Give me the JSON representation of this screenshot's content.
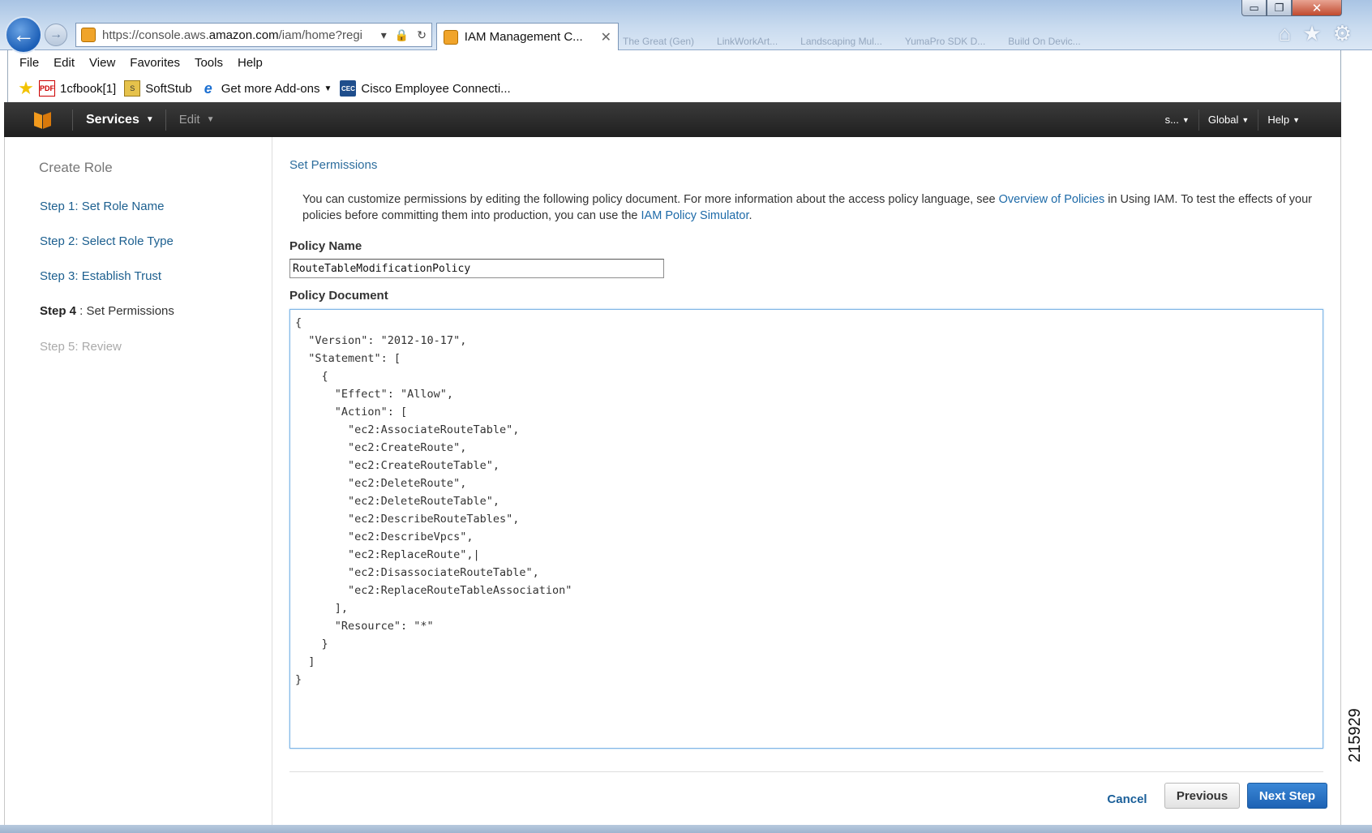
{
  "browser": {
    "window_buttons": [
      "▭",
      "❐",
      "✕"
    ],
    "back_icon": "←",
    "forward_icon": "→",
    "address": {
      "prefix": "https://console.aws.",
      "host": "amazon.com",
      "path": "/iam/home?regi"
    },
    "address_icons": [
      "▾",
      "🔒",
      "↻"
    ],
    "active_tab": {
      "title": "IAM Management C...",
      "close": "✕"
    },
    "background_tabs": [
      "The Great (Gen)",
      "LinkWorkArt...",
      "Landscaping Mul...",
      "YumaPro SDK D...",
      "Build On Devic..."
    ],
    "toolbar_icons": [
      "⌂",
      "★",
      "⚙"
    ],
    "menu": [
      "File",
      "Edit",
      "View",
      "Favorites",
      "Tools",
      "Help"
    ],
    "favorites": [
      {
        "label": "1cfbook[1]",
        "icon": "pdf-icon",
        "glyph": "PDF"
      },
      {
        "label": "SoftStub",
        "icon": "softstub-icon",
        "glyph": "S"
      },
      {
        "label": "Get more Add-ons",
        "icon": "ie-icon",
        "glyph": "e",
        "has_menu": true
      },
      {
        "label": "Cisco Employee Connecti...",
        "icon": "cec-icon",
        "glyph": "CEC"
      }
    ]
  },
  "aws_nav": {
    "services": "Services",
    "edit": "Edit",
    "account": "s...",
    "region": "Global",
    "help": "Help"
  },
  "sidebar": {
    "title": "Create Role",
    "steps": [
      {
        "label": "Step 1: Set Role Name",
        "state": "done"
      },
      {
        "label": "Step 2: Select Role Type",
        "state": "done"
      },
      {
        "label": "Step 3: Establish Trust",
        "state": "done"
      },
      {
        "label_bold": "Step 4",
        "label_rest": " : Set Permissions",
        "state": "current"
      },
      {
        "label": "Step 5: Review",
        "state": "future"
      }
    ]
  },
  "main": {
    "section_title": "Set Permissions",
    "intro": {
      "part1": "You can customize permissions by editing the following policy document. For more information about the access policy language, see ",
      "link1": "Overview of Policies",
      "part2": " in Using IAM. To test the effects of your policies before committing them into production, you can use the ",
      "link2": "IAM Policy Simulator",
      "part3": "."
    },
    "policy_name_label": "Policy Name",
    "policy_name_value": "RouteTableModificationPolicy",
    "policy_document_label": "Policy Document",
    "policy_document": "{\n  \"Version\": \"2012-10-17\",\n  \"Statement\": [\n    {\n      \"Effect\": \"Allow\",\n      \"Action\": [\n        \"ec2:AssociateRouteTable\",\n        \"ec2:CreateRoute\",\n        \"ec2:CreateRouteTable\",\n        \"ec2:DeleteRoute\",\n        \"ec2:DeleteRouteTable\",\n        \"ec2:DescribeRouteTables\",\n        \"ec2:DescribeVpcs\",\n        \"ec2:ReplaceRoute\",|\n        \"ec2:DisassociateRouteTable\",\n        \"ec2:ReplaceRouteTableAssociation\"\n      ],\n      \"Resource\": \"*\"\n    }\n  ]\n}",
    "buttons": {
      "cancel": "Cancel",
      "previous": "Previous",
      "next": "Next Step"
    }
  },
  "figure_id": "215929",
  "colors": {
    "aws_orange": "#f29a1d",
    "link": "#1d6aa8",
    "primary_button": "#1d62b4",
    "nav_bg": "#2a2a2a"
  }
}
